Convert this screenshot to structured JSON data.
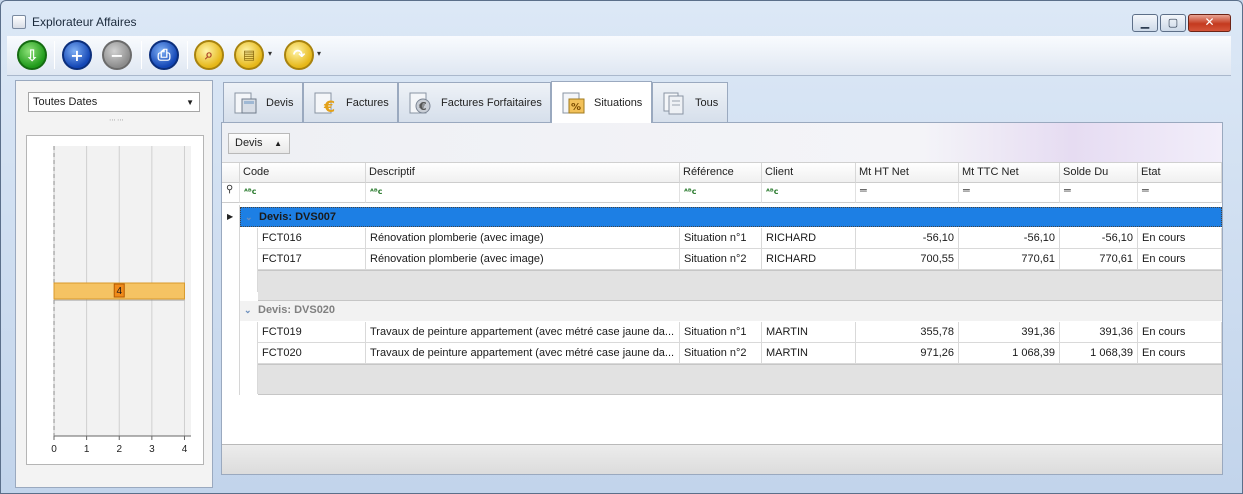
{
  "window": {
    "title": "Explorateur Affaires",
    "min_glyph": "▁",
    "max_glyph": "▢",
    "close_glyph": "✕"
  },
  "toolbar": {
    "buttons": [
      {
        "name": "refresh",
        "icon": "green-down-arrow-icon",
        "glyph": "⇩"
      },
      {
        "name": "add",
        "icon": "plus-icon",
        "glyph": "+"
      },
      {
        "name": "remove",
        "icon": "minus-icon",
        "glyph": "−"
      },
      {
        "name": "print",
        "icon": "printer-icon",
        "glyph": "⎙"
      },
      {
        "name": "search",
        "icon": "magnifier-icon",
        "glyph": "⌕"
      },
      {
        "name": "copy",
        "icon": "document-copy-icon",
        "glyph": "▤"
      },
      {
        "name": "transfer",
        "icon": "curved-arrow-icon",
        "glyph": "↷"
      }
    ],
    "dropdown_glyph": "▾"
  },
  "left_panel": {
    "date_filter": "Toutes Dates",
    "dropdown_glyph": "▼",
    "grip": "⋯⋯",
    "chart_data": {
      "type": "bar",
      "orientation": "horizontal",
      "values": [
        4
      ],
      "data_labels": [
        "4"
      ],
      "x_ticks": [
        "0",
        "1",
        "2",
        "3",
        "4"
      ],
      "xlim": [
        0,
        4.2
      ],
      "bar_color": "#f5c363",
      "grid": true
    }
  },
  "tabs": [
    {
      "label": "Devis",
      "icon": "calculator-icon",
      "active": false
    },
    {
      "label": "Factures",
      "icon": "euro-invoice-icon",
      "active": false
    },
    {
      "label": "Factures Forfaitaires",
      "icon": "euro-document-icon",
      "active": false
    },
    {
      "label": "Situations",
      "icon": "percent-document-icon",
      "active": true
    },
    {
      "label": "Tous",
      "icon": "documents-icon",
      "active": false
    }
  ],
  "grid": {
    "group_by_label": "Devis",
    "group_by_glyph": "▲",
    "columns": [
      {
        "key": "code",
        "label": "Code"
      },
      {
        "key": "descriptif",
        "label": "Descriptif"
      },
      {
        "key": "reference",
        "label": "Référence"
      },
      {
        "key": "client",
        "label": "Client"
      },
      {
        "key": "mt_ht",
        "label": "Mt HT Net"
      },
      {
        "key": "mt_ttc",
        "label": "Mt TTC Net"
      },
      {
        "key": "solde",
        "label": "Solde Du"
      },
      {
        "key": "etat",
        "label": "Etat"
      }
    ],
    "filter_text_glyph": "ᴬᴮc",
    "filter_eq_glyph": "═",
    "filter_pin_glyph": "⚲",
    "row_pointer_glyph": "▶",
    "groups": [
      {
        "label": "Devis: DVS007",
        "chev": "⌄",
        "selected": true,
        "rows": [
          {
            "code": "FCT016",
            "descriptif": "Rénovation plomberie (avec image)",
            "reference": "Situation n°1",
            "client": "RICHARD",
            "mt_ht": "-56,10",
            "mt_ttc": "-56,10",
            "solde": "-56,10",
            "etat": "En cours"
          },
          {
            "code": "FCT017",
            "descriptif": "Rénovation plomberie (avec image)",
            "reference": "Situation n°2",
            "client": "RICHARD",
            "mt_ht": "700,55",
            "mt_ttc": "770,61",
            "solde": "770,61",
            "etat": "En cours"
          }
        ]
      },
      {
        "label": "Devis: DVS020",
        "chev": "⌄",
        "selected": false,
        "rows": [
          {
            "code": "FCT019",
            "descriptif": "Travaux de peinture appartement (avec métré case jaune da...",
            "reference": "Situation n°1",
            "client": "MARTIN",
            "mt_ht": "355,78",
            "mt_ttc": "391,36",
            "solde": "391,36",
            "etat": "En cours"
          },
          {
            "code": "FCT020",
            "descriptif": "Travaux de peinture appartement (avec métré case jaune da...",
            "reference": "Situation n°2",
            "client": "MARTIN",
            "mt_ht": "971,26",
            "mt_ttc": "1 068,39",
            "solde": "1 068,39",
            "etat": "En cours"
          }
        ]
      }
    ]
  }
}
